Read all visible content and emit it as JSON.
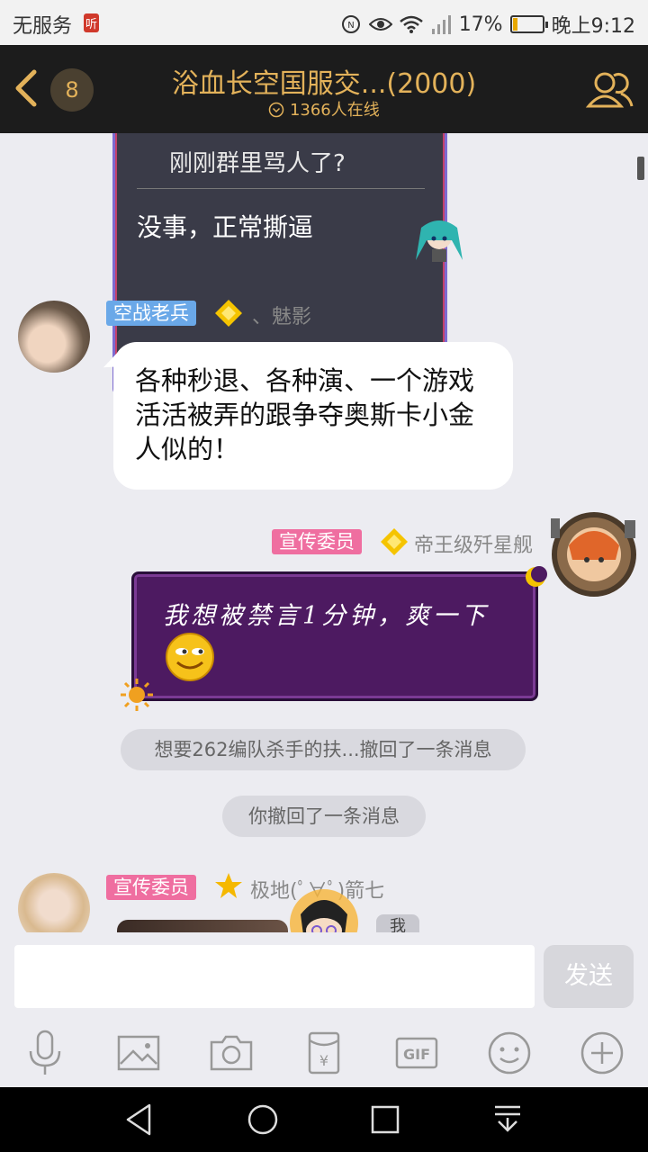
{
  "status_bar": {
    "carrier": "无服务",
    "listen_badge": "听",
    "battery": "17%",
    "time": "晚上9:12"
  },
  "header": {
    "unread_count": "8",
    "title": "浴血长空国服交...(2000)",
    "online": "1366人在线"
  },
  "messages": {
    "dark_bubble": {
      "quote": "刚刚群里骂人了?",
      "text": "没事，正常撕逼"
    },
    "msg1": {
      "title_tag": "空战老兵",
      "nickname": "、魅影",
      "text": "各种秒退、各种演、一个游戏活活被弄的跟争夺奥斯卡小金人似的！"
    },
    "msg2": {
      "title_tag": "宣传委员",
      "nickname": "帝王级歼星舰",
      "text": "我想被禁言1分钟，爽一下"
    },
    "system1": "想要262编队杀手的扶...撤回了一条消息",
    "system2": "你撤回了一条消息",
    "msg3": {
      "title_tag": "宣传委员",
      "nickname": "极地(ﾟ∀ﾟ)箭七",
      "me_label": "我"
    }
  },
  "input": {
    "placeholder": "",
    "send_label": "发送"
  },
  "toolbar": {
    "icons": [
      "microphone-icon",
      "image-icon",
      "camera-icon",
      "red-packet-icon",
      "gif-icon",
      "emoji-icon",
      "plus-icon"
    ],
    "gif_label": "GIF",
    "yen_label": "¥"
  },
  "colors": {
    "header_bg": "#1c1c1c",
    "header_accent": "#e3b25a",
    "tag_blue": "#6aa8e8",
    "tag_pink": "#ef6ea0",
    "purple_bubble": "#4d1a61"
  }
}
